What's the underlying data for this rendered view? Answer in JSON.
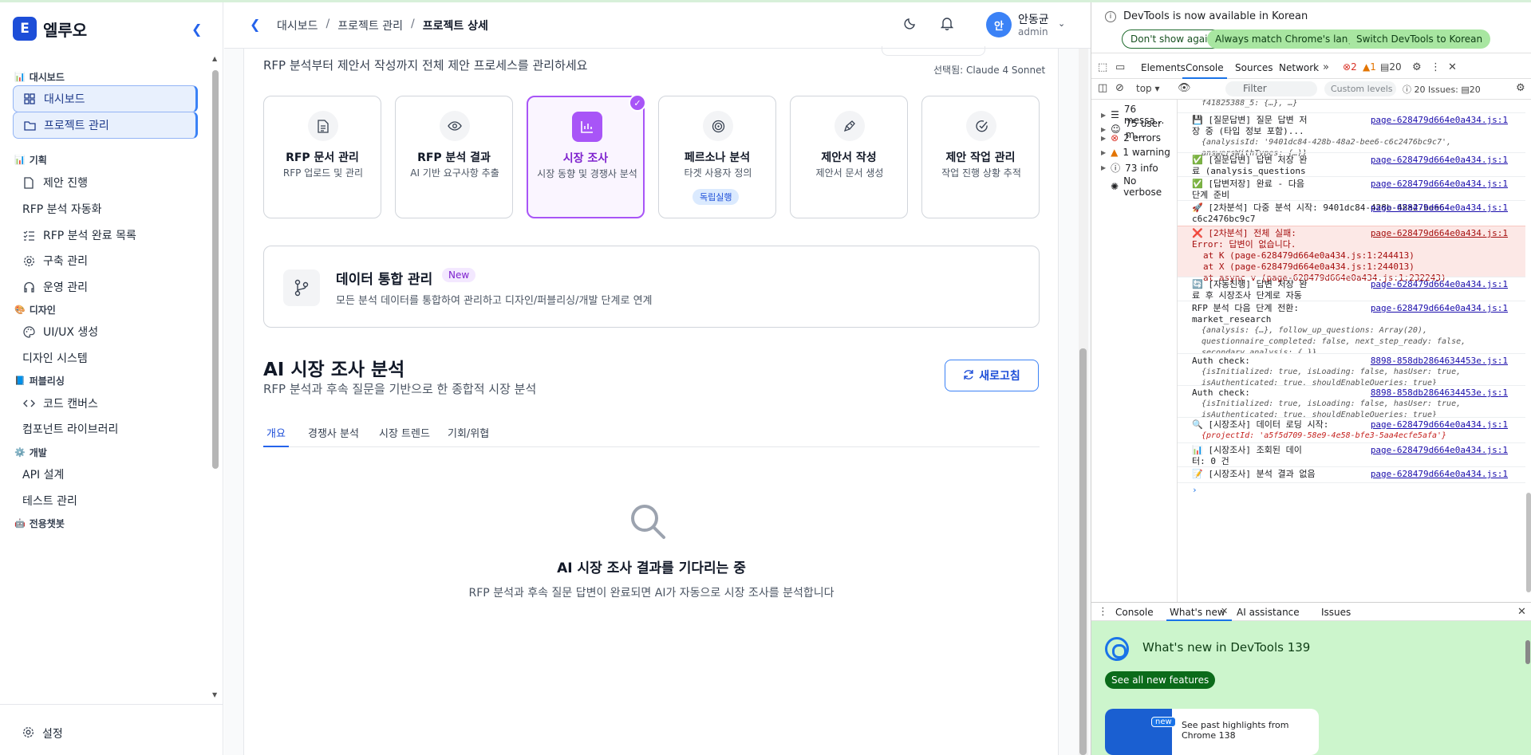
{
  "brand": {
    "logo_letter": "E",
    "name": "엘루오"
  },
  "sidebar": {
    "sections": [
      {
        "label": "대시보드",
        "icon": "chart-icon"
      },
      {
        "label": "기획",
        "icon": "chart-icon"
      },
      {
        "label": "디자인",
        "icon": "palette-icon"
      },
      {
        "label": "퍼블리싱",
        "icon": "book-icon"
      },
      {
        "label": "개발",
        "icon": "gear-icon"
      },
      {
        "label": "전용챗봇",
        "icon": "bot-icon"
      }
    ],
    "items": [
      {
        "label": "대시보드"
      },
      {
        "label": "프로젝트 관리"
      },
      {
        "label": "제안 진행"
      },
      {
        "label": "RFP 분석 자동화"
      },
      {
        "label": "RFP 분석 완료 목록"
      },
      {
        "label": "구축 관리"
      },
      {
        "label": "운영 관리"
      },
      {
        "label": "UI/UX 생성"
      },
      {
        "label": "디자인 시스템"
      },
      {
        "label": "코드 캔버스"
      },
      {
        "label": "컴포넌트 라이브러리"
      },
      {
        "label": "API 설계"
      },
      {
        "label": "테스트 관리"
      }
    ],
    "settings_label": "설정"
  },
  "header": {
    "breadcrumbs": [
      "대시보드",
      "프로젝트 관리",
      "프로젝트 상세"
    ],
    "user_initial": "안",
    "user_name": "안동균",
    "user_role": "admin"
  },
  "main": {
    "description": "RFP 분석부터 제안서 작성까지 전체 제안 프로세스를 관리하세요",
    "model_label": "선택됨: Claude 4 Sonnet",
    "cards": [
      {
        "title": "RFP 문서 관리",
        "sub": "RFP 업로드 및 관리",
        "icon": "document-icon"
      },
      {
        "title": "RFP 분석 결과",
        "sub": "AI 기반 요구사항 추출",
        "icon": "eye-icon"
      },
      {
        "title": "시장 조사",
        "sub": "시장 동향 및 경쟁사 분석",
        "icon": "bar-chart-icon"
      },
      {
        "title": "페르소나 분석",
        "sub": "타겟 사용자 정의",
        "icon": "target-icon",
        "badge": "독립실행"
      },
      {
        "title": "제안서 작성",
        "sub": "제안서 문서 생성",
        "icon": "pen-icon"
      },
      {
        "title": "제안 작업 관리",
        "sub": "작업 진행 상황 추적",
        "icon": "check-circle-icon"
      }
    ],
    "integration": {
      "title": "데이터 통합 관리",
      "badge": "New",
      "sub": "모든 분석 데이터를 통합하여 관리하고 디자인/퍼블리싱/개발 단계로 연계"
    },
    "section_title": "AI 시장 조사 분석",
    "section_sub": "RFP 분석과 후속 질문을 기반으로 한 종합적 시장 분석",
    "refresh_label": "새로고침",
    "tabs": [
      "개요",
      "경쟁사 분석",
      "시장 트렌드",
      "기회/위협"
    ],
    "empty_title": "AI 시장 조사 결과를 기다리는 중",
    "empty_sub": "RFP 분석과 후속 질문 답변이 완료되면 AI가 자동으로 시장 조사를 분석합니다"
  },
  "devtools": {
    "info_text": "DevTools is now available in Korean",
    "info_buttons": [
      "Don't show again",
      "Always match Chrome's language",
      "Switch DevTools to Korean"
    ],
    "tabs": [
      "Elements",
      "Console",
      "Sources",
      "Network"
    ],
    "error_count": "2",
    "warning_count": "1",
    "message_count": "20",
    "context": "top",
    "filter_placeholder": "Filter",
    "levels": "Custom levels",
    "issues_label": "20 Issues:",
    "issues_count": "20",
    "side_items": [
      {
        "label": "76 messa...",
        "icon": "list-icon"
      },
      {
        "label": "75 user m...",
        "icon": "user-icon"
      },
      {
        "label": "2 errors",
        "icon": "error-icon"
      },
      {
        "label": "1 warning",
        "icon": "warning-icon"
      },
      {
        "label": "73 info",
        "icon": "info-icon"
      },
      {
        "label": "No verbose",
        "icon": "bug-icon"
      }
    ],
    "logs": [
      {
        "text": "f41825388_5: {…}, …}",
        "src": ""
      },
      {
        "text": "💾 [질문답변] 질문 답변 저장 중 (타입 정보 포함)...",
        "obj": "{analysisId: '9401dc84-428b-48a2-bee6-c6c2476bc9c7', answersWithTypes: {…}}",
        "src": "page-628479d664e0a434.js:1"
      },
      {
        "text": "✅ [질문답변] 답변 저장 완료 (analysis_questions + rfp_analyses)",
        "src": "page-628479d664e0a434.js:1"
      },
      {
        "text": "✅ [답변저장] 완료 - 다음 단계 준비",
        "src": "page-628479d664e0a434.js:1"
      },
      {
        "text": "🚀 [2차분석] 다중 분석 시작: 9401dc84-428b-48a2-bee6-c6c2476bc9c7",
        "src": "page-628479d664e0a434.js:1"
      },
      {
        "text": "❌ [2차분석] 전체 실패: Error: 답변이 없습니다.",
        "stack": [
          "at K (page-628479d664e0a434.js:1:244413)",
          "at X (page-628479d664e0a434.js:1:244013)",
          "at async v (page-628479d664e0a434.js:1:232243)"
        ],
        "src": "page-628479d664e0a434.js:1"
      },
      {
        "text": "🔄 [자동진행] 답변 저장 완료 후 시장조사 단계로 자동 전환...",
        "src": "page-628479d664e0a434.js:1"
      },
      {
        "text": "RFP 분석 다음 단계 전환: market_research",
        "obj": "{analysis: {…}, follow_up_questions: Array(20), questionnaire_completed: false, next_step_ready: false, secondary_analysis: {…}}",
        "src": "page-628479d664e0a434.js:1"
      },
      {
        "text": "Auth check:",
        "obj": "{isInitialized: true, isLoading: false, hasUser: true, isAuthenticated: true, shouldEnableQueries: true}",
        "src": "8898-858db2864634453e.js:1"
      },
      {
        "text": "Auth check:",
        "obj": "{isInitialized: true, isLoading: false, hasUser: true, isAuthenticated: true, shouldEnableQueries: true}",
        "src": "8898-858db2864634453e.js:1"
      },
      {
        "text": "🔍 [시장조사] 데이터 로딩 시작:",
        "obj": "{projectId: 'a5f5d709-58e9-4e58-bfe3-5aa4ecfe5afa'}",
        "src": "page-628479d664e0a434.js:1"
      },
      {
        "text": "📊 [시장조사] 조회된 데이터: 0 건",
        "src": "page-628479d664e0a434.js:1"
      },
      {
        "text": "📝 [시장조사] 분석 결과 없음",
        "src": "page-628479d664e0a434.js:1"
      }
    ],
    "drawer_tabs": [
      "Console",
      "What's new",
      "AI assistance",
      "Issues"
    ],
    "whats_new_title": "What's new in DevTools 139",
    "whats_new_button": "See all new features",
    "highlight_badge": "new",
    "highlight_text": "See past highlights from Chrome 138"
  }
}
